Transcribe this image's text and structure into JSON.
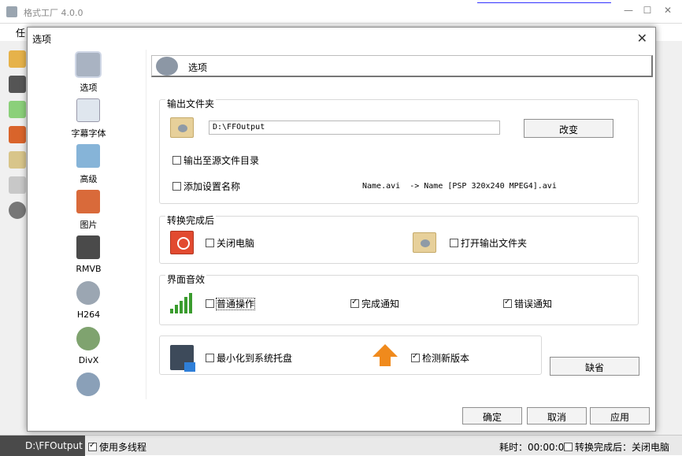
{
  "background": {
    "title": "格式工厂 4.0.0",
    "menu": "任",
    "min": "—",
    "max": "☐",
    "close": "✕"
  },
  "statusbar": {
    "path": "D:\\FFOutput",
    "multithread": "使用多线程",
    "elapsed": "耗时：00:00:00",
    "after_convert": "转换完成后：关闭电脑"
  },
  "dialog": {
    "title": "选项",
    "close": "✕",
    "nav": [
      {
        "label": "选项",
        "icon": "options-icon",
        "color": "#a9b3c2"
      },
      {
        "label": "字幕字体",
        "icon": "document-icon",
        "color": "#dfe6ee"
      },
      {
        "label": "高级",
        "icon": "image-icon",
        "color": "#86b4d8"
      },
      {
        "label": "图片",
        "icon": "paint-icon",
        "color": "#d96a3a"
      },
      {
        "label": "RMVB",
        "icon": "video-clip-icon",
        "color": "#4a4a4a"
      },
      {
        "label": "H264",
        "icon": "film-reel-icon",
        "color": "#9ba6b2"
      },
      {
        "label": "DivX",
        "icon": "film-reel-icon",
        "color": "#7fa36f"
      },
      {
        "label": "",
        "icon": "film-reel-icon",
        "color": "#8aa0b8"
      }
    ],
    "header": "选项",
    "output": {
      "title": "输出文件夹",
      "path": "D:\\FFOutput",
      "change": "改变",
      "to_source": "输出至源文件目录",
      "add_setting_name": "添加设置名称",
      "example": "Name.avi  -> Name [PSP 320x240 MPEG4].avi"
    },
    "after": {
      "title": "转换完成后",
      "shutdown": "关闭电脑",
      "open_folder": "打开输出文件夹"
    },
    "sound": {
      "title": "界面音效",
      "normal": "普通操作",
      "done": "完成通知",
      "error": "错误通知"
    },
    "misc": {
      "minimize": "最小化到系统托盘",
      "check_update": "检测新版本"
    },
    "default": "缺省",
    "ok": "确定",
    "cancel": "取消",
    "apply": "应用"
  }
}
